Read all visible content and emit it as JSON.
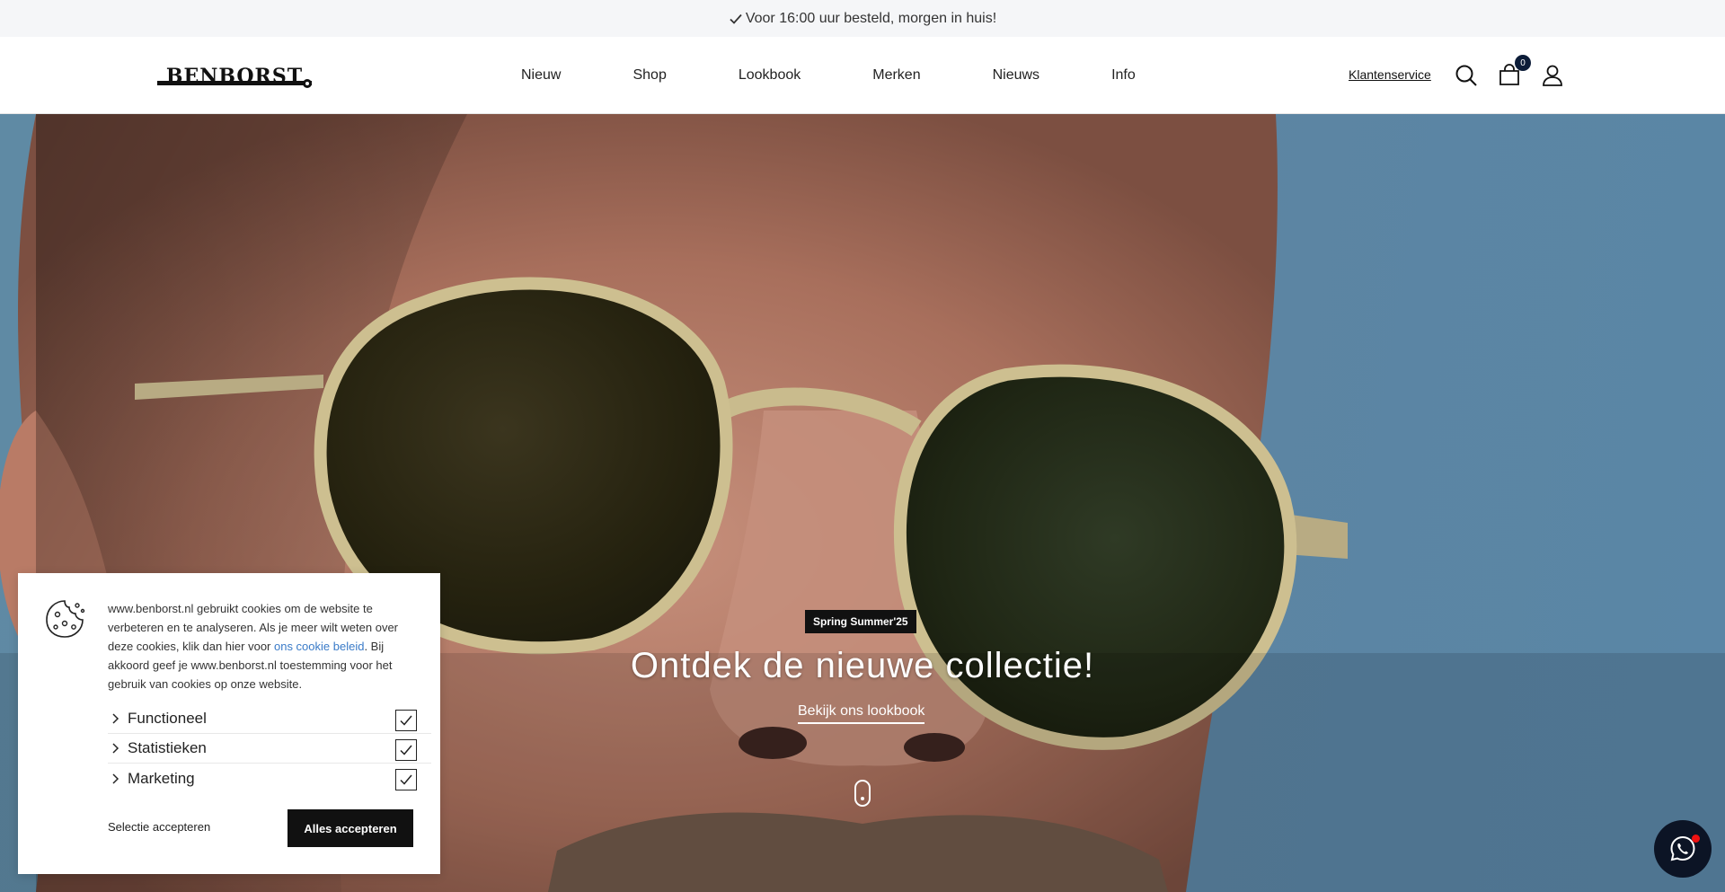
{
  "topbar": {
    "text": "Voor 16:00 uur besteld, morgen in huis!"
  },
  "header": {
    "logo_text": "BENBORST",
    "nav": [
      "Nieuw",
      "Shop",
      "Lookbook",
      "Merken",
      "Nieuws",
      "Info"
    ],
    "service_link": "Klantenservice",
    "cart_count": "0",
    "icons": [
      "search-icon",
      "cart-icon",
      "account-icon"
    ]
  },
  "hero": {
    "badge": "Spring Summer'25",
    "title": "Ontdek de nieuwe collectie!",
    "link": "Bekijk ons lookbook"
  },
  "cookie": {
    "text_before": "www.benborst.nl gebruikt cookies om de website te verbeteren en te analyseren. Als je meer wilt weten over deze cookies, klik dan hier voor ",
    "link": "ons cookie beleid",
    "text_after": ". Bij akkoord geef je www.benborst.nl toestemming voor het gebruik van cookies op onze website.",
    "options": [
      {
        "label": "Functioneel",
        "checked": true
      },
      {
        "label": "Statistieken",
        "checked": true
      },
      {
        "label": "Marketing",
        "checked": true
      }
    ],
    "select_button": "Selectie accepteren",
    "accept_button": "Alles accepteren"
  },
  "colors": {
    "accent": "#0c1c38",
    "link": "#3a7bc8",
    "sky": "#5d84a0"
  }
}
